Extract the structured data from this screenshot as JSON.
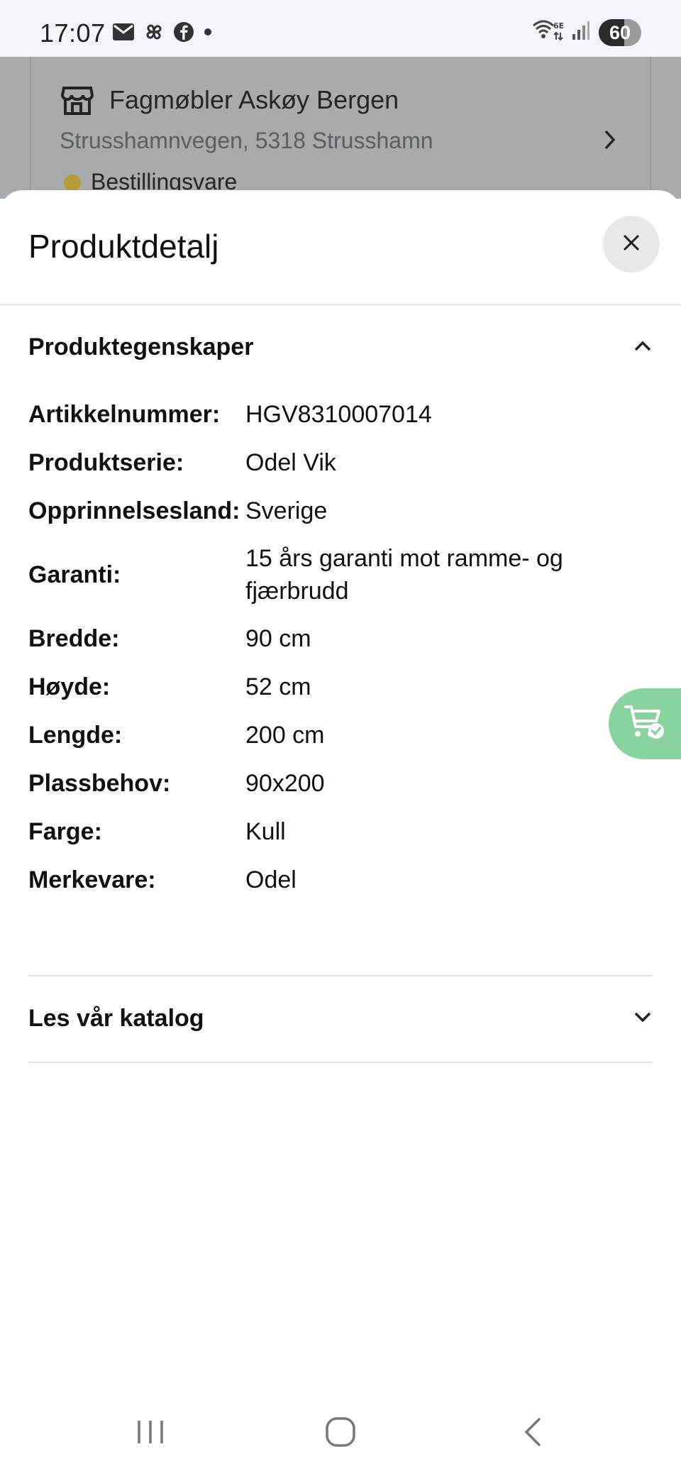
{
  "status_bar": {
    "time": "17:07",
    "icons_left": [
      "gmail-icon",
      "pinwheel-icon",
      "facebook-icon",
      "dot-icon"
    ],
    "icons_right": [
      "wifi-6e-icon",
      "signal-icon",
      "battery-icon"
    ],
    "battery_level": "60",
    "battery_fraction": 0.6
  },
  "background": {
    "store_name": "Fagmøbler Askøy Bergen",
    "store_address": "Strusshamnvegen, 5318 Strusshamn",
    "store_status": "Bestillingsvare",
    "status_dot_color": "#b89a36",
    "overlay_color": "#a7abad"
  },
  "sheet": {
    "title": "Produktdetalj",
    "properties_section": {
      "title": "Produktegenskaper",
      "expanded": true,
      "rows": [
        {
          "label": "Artikkelnummer:",
          "value": "HGV8310007014"
        },
        {
          "label": "Produktserie:",
          "value": "Odel Vik"
        },
        {
          "label": "Opprinnelsesland:",
          "value": "Sverige"
        },
        {
          "label": "Garanti:",
          "value": "15 års garanti mot ramme- og fjærbrudd"
        },
        {
          "label": "Bredde:",
          "value": "90 cm"
        },
        {
          "label": "Høyde:",
          "value": "52 cm"
        },
        {
          "label": "Lengde:",
          "value": "200 cm"
        },
        {
          "label": "Plassbehov:",
          "value": "90x200"
        },
        {
          "label": "Farge:",
          "value": "Kull"
        },
        {
          "label": "Merkevare:",
          "value": "Odel"
        }
      ]
    },
    "catalog_section": {
      "title": "Les vår katalog",
      "expanded": false
    }
  },
  "cart_fab": {
    "color": "#88d39e",
    "icon": "cart-check-icon"
  },
  "nav_bar": {
    "buttons": [
      "recent-apps-icon",
      "home-icon",
      "back-icon"
    ]
  }
}
